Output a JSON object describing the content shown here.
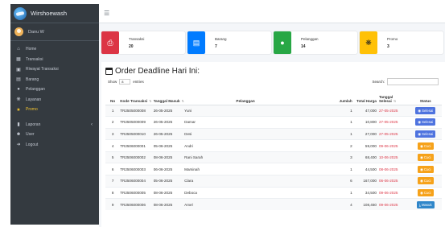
{
  "brand": {
    "name": "Wirshoewash"
  },
  "user": {
    "name": "Danu W"
  },
  "sidebar": {
    "items": [
      {
        "label": "Home",
        "icon": "house"
      },
      {
        "label": "Transaksi",
        "icon": "table"
      },
      {
        "label": "Riwayat Transaksi",
        "icon": "truck"
      },
      {
        "label": "Barang",
        "icon": "cart"
      },
      {
        "label": "Pelanggan",
        "icon": "users"
      },
      {
        "label": "Layanan",
        "icon": "gear"
      },
      {
        "label": "Promo",
        "icon": "star"
      },
      {
        "label": "Laporan",
        "icon": "file"
      },
      {
        "label": "User",
        "icon": "user"
      },
      {
        "label": "Logout",
        "icon": "logout"
      }
    ]
  },
  "cards": [
    {
      "label": "Transaksi",
      "value": "20",
      "color": "#dc3545",
      "icon": "printer"
    },
    {
      "label": "Barang",
      "value": "7",
      "color": "#007bff",
      "icon": "cart"
    },
    {
      "label": "Pelanggan",
      "value": "14",
      "color": "#28a745",
      "icon": "users"
    },
    {
      "label": "Promo",
      "value": "3",
      "color": "#ffc107",
      "icon": "gear"
    }
  ],
  "table": {
    "title": "Order Deadline Hari Ini:",
    "show_prefix": "Show",
    "show_value": "8",
    "show_suffix": "entries",
    "search_label": "Search:",
    "headers": {
      "no": "No",
      "kode": "Kode Transaksi",
      "masuk": "Tanggal Masuk",
      "pelanggan": "Pelanggan",
      "jumlah": "Jumlah",
      "total": "Total Harga",
      "selesai": "Tanggal Selesai",
      "status": "Status"
    },
    "rows": [
      {
        "no": "1",
        "kode": "TR2505000008",
        "masuk": "26-05-2025",
        "pelanggan": "Yuni",
        "jumlah": "1",
        "total": "47,000",
        "selesai": "27-05-2025",
        "status": "Selesai",
        "status_type": "blue"
      },
      {
        "no": "2",
        "kode": "TR2505000009",
        "masuk": "26-05-2025",
        "pelanggan": "Damar",
        "jumlah": "1",
        "total": "10,800",
        "selesai": "27-05-2025",
        "status": "Selesai",
        "status_type": "blue"
      },
      {
        "no": "3",
        "kode": "TR2505000010",
        "masuk": "26-05-2025",
        "pelanggan": "Desi",
        "jumlah": "1",
        "total": "27,000",
        "selesai": "27-05-2025",
        "status": "Selesai",
        "status_type": "blue"
      },
      {
        "no": "4",
        "kode": "TR2506000001",
        "masuk": "05-06-2025",
        "pelanggan": "Andri",
        "jumlah": "2",
        "total": "59,000",
        "selesai": "09-06-2025",
        "status": "Cuci",
        "status_type": "orange"
      },
      {
        "no": "5",
        "kode": "TR2506000002",
        "masuk": "08-06-2025",
        "pelanggan": "Rani Sarah",
        "jumlah": "3",
        "total": "68,400",
        "selesai": "10-06-2025",
        "status": "Cuci",
        "status_type": "orange"
      },
      {
        "no": "6",
        "kode": "TR2506000003",
        "masuk": "06-06-2025",
        "pelanggan": "Marsinah",
        "jumlah": "1",
        "total": "44,500",
        "selesai": "08-06-2025",
        "status": "Cuci",
        "status_type": "orange"
      },
      {
        "no": "7",
        "kode": "TR2506000004",
        "masuk": "05-06-2025",
        "pelanggan": "Clara",
        "jumlah": "6",
        "total": "167,000",
        "selesai": "06-06-2025",
        "status": "Cuci",
        "status_type": "orange"
      },
      {
        "no": "8",
        "kode": "TR2506000005",
        "masuk": "08-06-2025",
        "pelanggan": "Deboca",
        "jumlah": "1",
        "total": "34,500",
        "selesai": "09-06-2025",
        "status": "Cuci",
        "status_type": "orange"
      },
      {
        "no": "9",
        "kode": "TR2506000006",
        "masuk": "08-06-2025",
        "pelanggan": "Amel",
        "jumlah": "4",
        "total": "108,450",
        "selesai": "09-06-2025",
        "status": "Masuk",
        "status_type": "teal"
      }
    ]
  }
}
